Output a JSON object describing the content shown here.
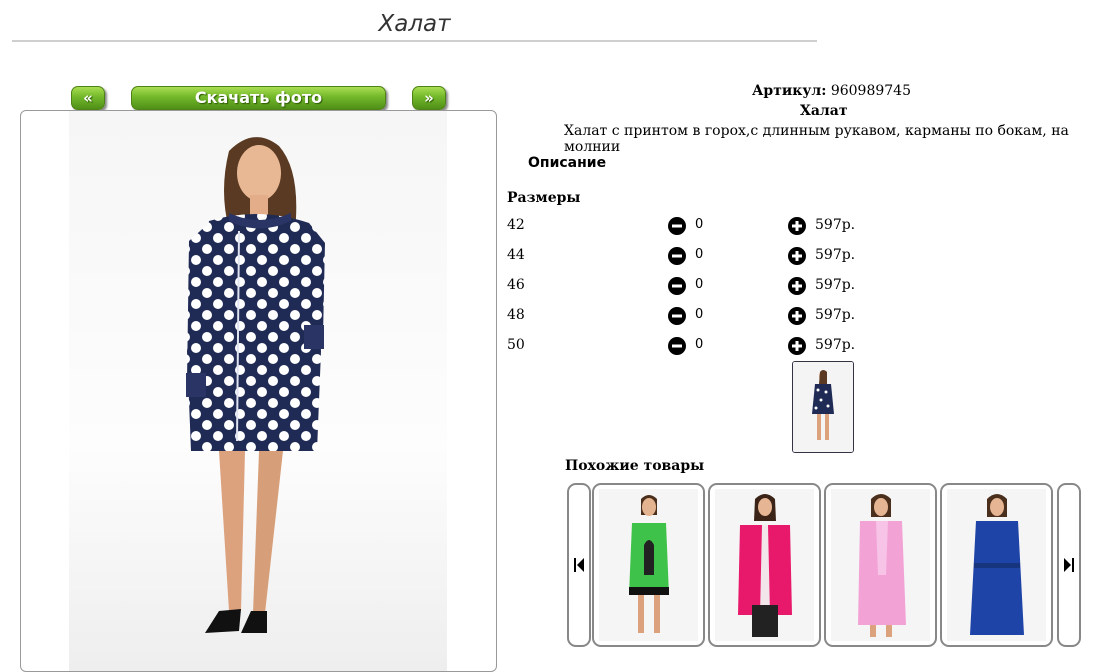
{
  "page": {
    "title": "Халат"
  },
  "gallery": {
    "prev_label": "«",
    "download_label": "Скачать фото",
    "next_label": "»"
  },
  "product": {
    "article_label": "Артикул:",
    "article_value": "960989745",
    "name": "Халат",
    "description": "Халат с принтом в горох,с длинным рукавом, карманы по бокам, на молнии",
    "description_label": "Описание",
    "sizes_label": "Размеры",
    "sizes": [
      {
        "size": "42",
        "qty": "0",
        "price": "597р."
      },
      {
        "size": "44",
        "qty": "0",
        "price": "597р."
      },
      {
        "size": "46",
        "qty": "0",
        "price": "597р."
      },
      {
        "size": "48",
        "qty": "0",
        "price": "597р."
      },
      {
        "size": "50",
        "qty": "0",
        "price": "597р."
      }
    ]
  },
  "similar": {
    "label": "Похожие товары",
    "items": [
      {
        "icon": "green-dress-thumbnail",
        "color": "#3fc24a"
      },
      {
        "icon": "pink-vest-thumbnail",
        "color": "#e8196a"
      },
      {
        "icon": "light-pink-robe-thumbnail",
        "color": "#f3a2d6"
      },
      {
        "icon": "blue-robe-thumbnail",
        "color": "#1f44a8"
      }
    ]
  },
  "colors": {
    "accent_green": "#73b82b",
    "dress_navy": "#1f2a55"
  }
}
